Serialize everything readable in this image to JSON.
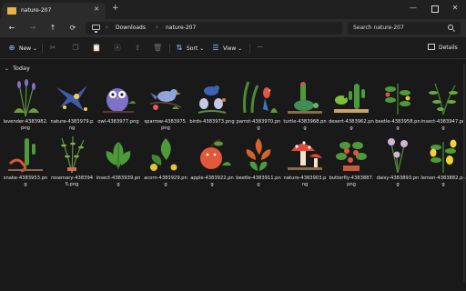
{
  "window": {
    "tab_title": "nature-207",
    "close_glyph": "✕",
    "new_tab_glyph": "+",
    "minimize_glyph": "—",
    "close_window_glyph": "✕"
  },
  "nav": {
    "back_glyph": "←",
    "forward_glyph": "→",
    "up_glyph": "↑",
    "refresh_glyph": "⟳",
    "breadcrumbs": [
      "Downloads",
      "nature-207"
    ],
    "separator": "›",
    "search_placeholder": "Search nature-207"
  },
  "toolbar": {
    "new_label": "New",
    "new_glyph": "⊕",
    "dropdown_glyph": "⌄",
    "sort_label": "Sort",
    "view_label": "View",
    "more_glyph": "···",
    "details_label": "Details",
    "cut_glyph": "✂",
    "copy_glyph": "❐",
    "paste_glyph": "📋",
    "rename_glyph": "Ⓐ",
    "share_glyph": "⇪",
    "delete_glyph": "🗑"
  },
  "group": {
    "title": "Today",
    "chevron": "⌄"
  },
  "files": [
    {
      "name": "lavender-4383982.png",
      "icon": "lavender-illustration"
    },
    {
      "name": "nature-4383979.png",
      "icon": "swallow-illustration"
    },
    {
      "name": "owl-4383977.png",
      "icon": "owl-illustration"
    },
    {
      "name": "sparrow-4383975.png",
      "icon": "sparrow-illustration"
    },
    {
      "name": "birds-4383973.png",
      "icon": "birds-illustration"
    },
    {
      "name": "parrot-4383970.png",
      "icon": "parrot-illustration"
    },
    {
      "name": "turtle-4383968.png",
      "icon": "turtle-illustration"
    },
    {
      "name": "desert-4383962.png",
      "icon": "desert-illustration"
    },
    {
      "name": "beetle-4383958.png",
      "icon": "beetle-illustration"
    },
    {
      "name": "insect-4383947.png",
      "icon": "insect-illustration"
    },
    {
      "name": "snake-4383953.png",
      "icon": "snake-illustration"
    },
    {
      "name": "rosemary-4383945.png",
      "icon": "rosemary-illustration"
    },
    {
      "name": "insect-4383939.png",
      "icon": "insect-illustration"
    },
    {
      "name": "acorn-4383929.png",
      "icon": "acorn-illustration"
    },
    {
      "name": "apple-4383922.png",
      "icon": "apple-illustration"
    },
    {
      "name": "beetle-4383911.png",
      "icon": "beetle-illustration"
    },
    {
      "name": "nature-4383903.png",
      "icon": "mushroom-illustration"
    },
    {
      "name": "butterfly-4383887.png",
      "icon": "butterfly-illustration"
    },
    {
      "name": "daisy-4383893.png",
      "icon": "daisy-illustration"
    },
    {
      "name": "lemon-4383882.png",
      "icon": "lemon-illustration"
    }
  ]
}
